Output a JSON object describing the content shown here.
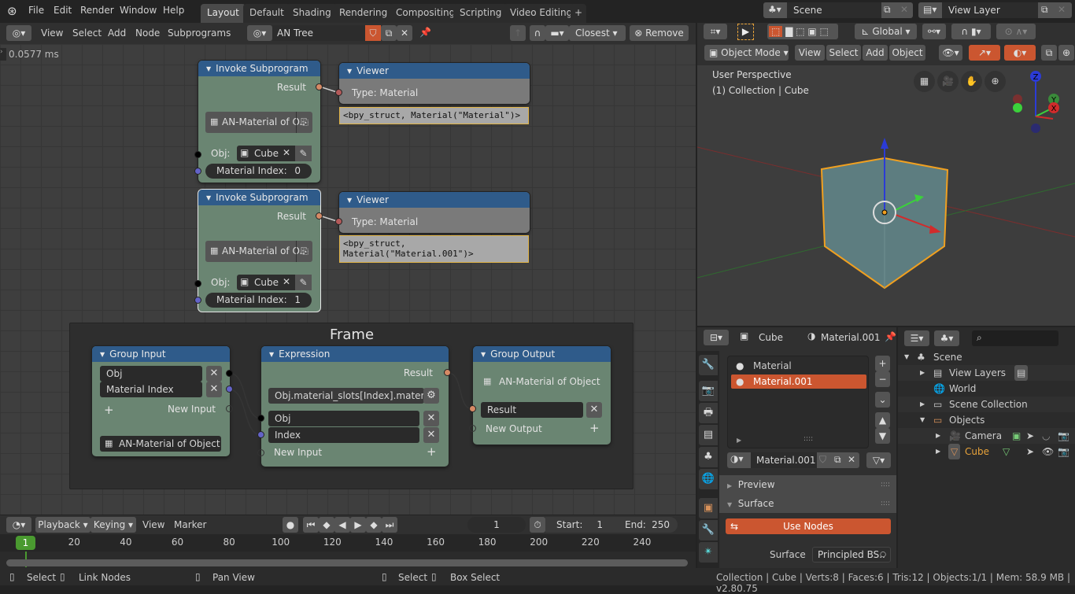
{
  "topbar": {
    "menu": [
      "File",
      "Edit",
      "Render",
      "Window",
      "Help"
    ],
    "workspaces": [
      "Layout",
      "Default",
      "Shading",
      "Rendering",
      "Compositing",
      "Scripting",
      "Video Editing"
    ],
    "active_workspace": "Layout",
    "add_tab": "+",
    "scene": "Scene",
    "view_layer": "View Layer"
  },
  "node_header": {
    "menu": [
      "View",
      "Select",
      "Add",
      "Node",
      "Subprograms"
    ],
    "tree_name": "AN Tree",
    "snap_mode": "Closest",
    "remove_label": "Remove"
  },
  "node_editor": {
    "timing": "0.0577 ms",
    "invoke_nodes": [
      {
        "title": "Invoke Subprogram",
        "output": "Result",
        "subprogram": "AN-Material of O..",
        "obj_label": "Obj:",
        "obj_value": "Cube",
        "index_label": "Material Index:",
        "index_value": "0"
      },
      {
        "title": "Invoke Subprogram",
        "output": "Result",
        "subprogram": "AN-Material of O..",
        "obj_label": "Obj:",
        "obj_value": "Cube",
        "index_label": "Material Index:",
        "index_value": "1"
      }
    ],
    "viewer_nodes": [
      {
        "title": "Viewer",
        "type": "Type: Material",
        "text": "<bpy_struct, Material(\"Material\")>"
      },
      {
        "title": "Viewer",
        "type": "Type: Material",
        "text": "<bpy_struct,\nMaterial(\"Material.001\")>"
      }
    ],
    "frame": {
      "label": "Frame",
      "group_input": {
        "title": "Group Input",
        "inputs": [
          "Obj",
          "Material Index"
        ],
        "new_input": "New Input",
        "subprogram": "AN-Material of Object"
      },
      "expression": {
        "title": "Expression",
        "output": "Result",
        "expression": "Obj.material_slots[Index].material",
        "inputs": [
          "Obj",
          "Index"
        ],
        "new_input": "New Input"
      },
      "group_output": {
        "title": "Group Output",
        "subprogram": "AN-Material of Object",
        "outputs": [
          "Result"
        ],
        "new_output": "New Output"
      }
    }
  },
  "viewport_header": {
    "mode": "Object Mode",
    "menu": [
      "View",
      "Select",
      "Add",
      "Object"
    ],
    "transform_orientation": "Global"
  },
  "viewport": {
    "perspective": "User Perspective",
    "collection": "(1) Collection | Cube",
    "axes": [
      "X",
      "Y",
      "Z"
    ]
  },
  "properties": {
    "object": "Cube",
    "material": "Material.001",
    "slots": [
      "Material",
      "Material.001"
    ],
    "selected_slot": "Material.001",
    "material_datablock": "Material.001",
    "panels": [
      "Preview",
      "Surface"
    ],
    "use_nodes_label": "Use Nodes",
    "surface_label": "Surface",
    "surface_value": "Principled BS..",
    "accent": "#cb5630"
  },
  "outliner": {
    "search_placeholder": "",
    "items": [
      {
        "label": "Scene",
        "depth": 0
      },
      {
        "label": "View Layers",
        "depth": 1
      },
      {
        "label": "World",
        "depth": 1
      },
      {
        "label": "Scene Collection",
        "depth": 1
      },
      {
        "label": "Objects",
        "depth": 1
      },
      {
        "label": "Camera",
        "depth": 2
      },
      {
        "label": "Cube",
        "depth": 2
      }
    ]
  },
  "timeline": {
    "menu": [
      "Playback",
      "Keying",
      "View",
      "Marker"
    ],
    "current_frame": "1",
    "start_label": "Start:",
    "start": "1",
    "end_label": "End:",
    "end": "250",
    "ticks": [
      "20",
      "40",
      "60",
      "80",
      "100",
      "120",
      "140",
      "160",
      "180",
      "200",
      "220",
      "240"
    ],
    "playhead": "1"
  },
  "statusbar": {
    "hints": [
      "Select",
      "Link Nodes",
      "Pan View",
      "Select",
      "Box Select"
    ],
    "stats": "Collection | Cube | Verts:8 | Faces:6 | Tris:12 | Objects:1/1 | Mem: 58.9 MB | v2.80.75"
  }
}
